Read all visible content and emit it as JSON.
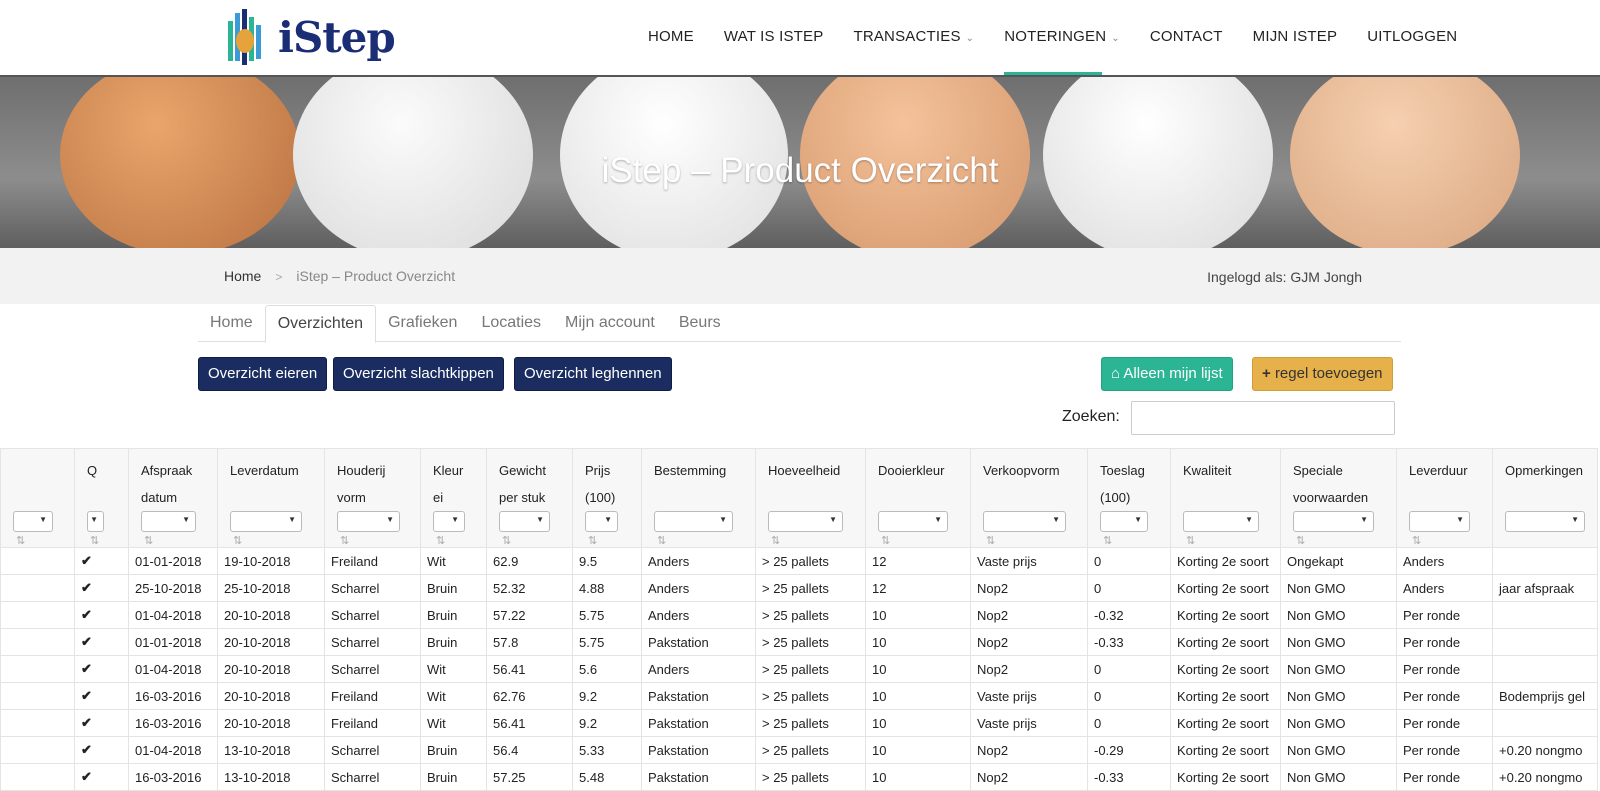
{
  "brand": {
    "name": "iStep"
  },
  "nav": [
    {
      "label": "HOME",
      "dropdown": false,
      "active": false
    },
    {
      "label": "WAT IS ISTEP",
      "dropdown": false,
      "active": false
    },
    {
      "label": "TRANSACTIES",
      "dropdown": true,
      "active": false
    },
    {
      "label": "NOTERINGEN",
      "dropdown": true,
      "active": true
    },
    {
      "label": "CONTACT",
      "dropdown": false,
      "active": false
    },
    {
      "label": "MIJN ISTEP",
      "dropdown": false,
      "active": false
    },
    {
      "label": "UITLOGGEN",
      "dropdown": false,
      "active": false
    }
  ],
  "hero": {
    "title": "iStep – Product Overzicht"
  },
  "breadcrumb": {
    "home": "Home",
    "current": "iStep – Product Overzicht"
  },
  "login_text": "Ingelogd als: GJM Jongh",
  "tabs": [
    {
      "label": "Home",
      "active": false
    },
    {
      "label": "Overzichten",
      "active": true
    },
    {
      "label": "Grafieken",
      "active": false
    },
    {
      "label": "Locaties",
      "active": false
    },
    {
      "label": "Mijn account",
      "active": false
    },
    {
      "label": "Beurs",
      "active": false
    }
  ],
  "buttons": {
    "eieren": "Overzicht eieren",
    "slachtkippen": "Overzicht slachtkippen",
    "leghennen": "Overzicht leghennen",
    "mijn_lijst": "Alleen mijn lijst",
    "toevoegen": "regel toevoegen"
  },
  "search": {
    "label": "Zoeken:",
    "value": ""
  },
  "table": {
    "columns": [
      "",
      "Q",
      "Afspraak datum",
      "Leverdatum",
      "Houderij vorm",
      "Kleur ei",
      "Gewicht per stuk",
      "Prijs (100)",
      "Bestemming",
      "Hoeveelheid",
      "Dooierkleur",
      "Verkoopvorm",
      "Toeslag (100)",
      "Kwaliteit",
      "Speciale voorwaarden",
      "Leverduur",
      "Opmerkingen"
    ],
    "rows": [
      [
        "",
        "✔",
        "01-01-2018",
        "19-10-2018",
        "Freiland",
        "Wit",
        "62.9",
        "9.5",
        "Anders",
        "> 25 pallets",
        "12",
        "Vaste prijs",
        "0",
        "Korting 2e soort",
        "Ongekapt",
        "Anders",
        ""
      ],
      [
        "",
        "✔",
        "25-10-2018",
        "25-10-2018",
        "Scharrel",
        "Bruin",
        "52.32",
        "4.88",
        "Anders",
        "> 25 pallets",
        "12",
        "Nop2",
        "0",
        "Korting 2e soort",
        "Non GMO",
        "Anders",
        "jaar afspraak"
      ],
      [
        "",
        "✔",
        "01-04-2018",
        "20-10-2018",
        "Scharrel",
        "Bruin",
        "57.22",
        "5.75",
        "Anders",
        "> 25 pallets",
        "10",
        "Nop2",
        "-0.32",
        "Korting 2e soort",
        "Non GMO",
        "Per ronde",
        ""
      ],
      [
        "",
        "✔",
        "01-01-2018",
        "20-10-2018",
        "Scharrel",
        "Bruin",
        "57.8",
        "5.75",
        "Pakstation",
        "> 25 pallets",
        "10",
        "Nop2",
        "-0.33",
        "Korting 2e soort",
        "Non GMO",
        "Per ronde",
        ""
      ],
      [
        "",
        "✔",
        "01-04-2018",
        "20-10-2018",
        "Scharrel",
        "Wit",
        "56.41",
        "5.6",
        "Anders",
        "> 25 pallets",
        "10",
        "Nop2",
        "0",
        "Korting 2e soort",
        "Non GMO",
        "Per ronde",
        ""
      ],
      [
        "",
        "✔",
        "16-03-2016",
        "20-10-2018",
        "Freiland",
        "Wit",
        "62.76",
        "9.2",
        "Pakstation",
        "> 25 pallets",
        "10",
        "Vaste prijs",
        "0",
        "Korting 2e soort",
        "Non GMO",
        "Per ronde",
        "Bodemprijs gel"
      ],
      [
        "",
        "✔",
        "16-03-2016",
        "20-10-2018",
        "Freiland",
        "Wit",
        "56.41",
        "9.2",
        "Pakstation",
        "> 25 pallets",
        "10",
        "Vaste prijs",
        "0",
        "Korting 2e soort",
        "Non GMO",
        "Per ronde",
        ""
      ],
      [
        "",
        "✔",
        "01-04-2018",
        "13-10-2018",
        "Scharrel",
        "Bruin",
        "56.4",
        "5.33",
        "Pakstation",
        "> 25 pallets",
        "10",
        "Nop2",
        "-0.29",
        "Korting 2e soort",
        "Non GMO",
        "Per ronde",
        "+0.20 nongmo"
      ],
      [
        "",
        "✔",
        "16-03-2016",
        "13-10-2018",
        "Scharrel",
        "Bruin",
        "57.25",
        "5.48",
        "Pakstation",
        "> 25 pallets",
        "10",
        "Nop2",
        "-0.33",
        "Korting 2e soort",
        "Non GMO",
        "Per ronde",
        "+0.20 nongmo"
      ]
    ]
  },
  "colors": {
    "accent": "#2bb594",
    "navy": "#1b2d60",
    "orange": "#e6b04b",
    "check": "#2e8b3a"
  }
}
